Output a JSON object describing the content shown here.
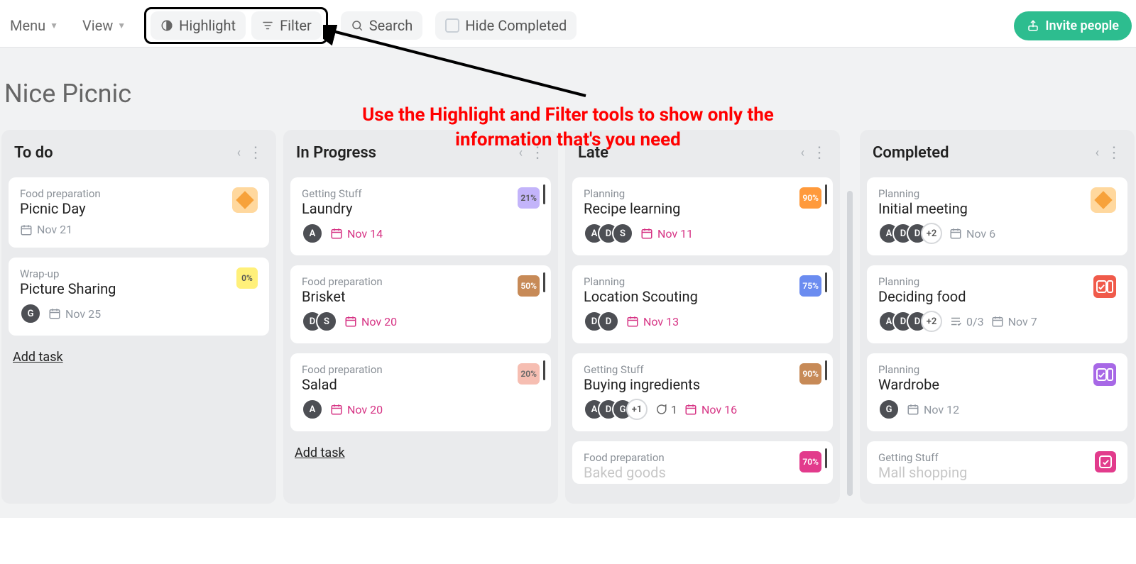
{
  "toolbar": {
    "menu": "Menu",
    "view": "View",
    "highlight": "Highlight",
    "filter": "Filter",
    "search": "Search",
    "hide_completed": "Hide Completed",
    "invite": "Invite people"
  },
  "annotation": {
    "line1": "Use the Highlight and Filter tools to show only the",
    "line2": "information that's you need"
  },
  "board": {
    "title": "Nice Picnic",
    "add_task": "Add task"
  },
  "columns": [
    {
      "title": "To do"
    },
    {
      "title": "In Progress"
    },
    {
      "title": "Late"
    },
    {
      "title": "Completed"
    }
  ],
  "cards": {
    "todo": [
      {
        "cat": "Food preparation",
        "title": "Picnic Day",
        "badge_type": "diamond",
        "badge_text": "",
        "date": "Nov 21",
        "date_style": "grey",
        "avatars": [],
        "more": ""
      },
      {
        "cat": "Wrap-up",
        "title": "Picture Sharing",
        "badge_type": "yellow",
        "badge_text": "0%",
        "date": "Nov 25",
        "date_style": "grey",
        "avatars": [
          "G"
        ],
        "more": ""
      }
    ],
    "inprogress": [
      {
        "cat": "Getting Stuff",
        "title": "Laundry",
        "badge_type": "purple",
        "badge_text": "21%",
        "date": "Nov 14",
        "date_style": "pink",
        "avatars": [
          "A"
        ],
        "more": ""
      },
      {
        "cat": "Food preparation",
        "title": "Brisket",
        "badge_type": "brown",
        "badge_text": "50%",
        "date": "Nov 20",
        "date_style": "pink",
        "avatars": [
          "D",
          "S"
        ],
        "more": ""
      },
      {
        "cat": "Food preparation",
        "title": "Salad",
        "badge_type": "salmon",
        "badge_text": "20%",
        "date": "Nov 20",
        "date_style": "pink",
        "avatars": [
          "A"
        ],
        "more": ""
      }
    ],
    "late": [
      {
        "cat": "Planning",
        "title": "Recipe learning",
        "badge_type": "orange",
        "badge_text": "90%",
        "date": "Nov 11",
        "date_style": "pink",
        "avatars": [
          "A",
          "D",
          "S"
        ],
        "more": ""
      },
      {
        "cat": "Planning",
        "title": "Location Scouting",
        "badge_type": "blue",
        "badge_text": "75%",
        "date": "Nov 13",
        "date_style": "pink",
        "avatars": [
          "D",
          "D"
        ],
        "more": ""
      },
      {
        "cat": "Getting Stuff",
        "title": "Buying ingredients",
        "badge_type": "brown",
        "badge_text": "90%",
        "date": "Nov 16",
        "date_style": "pink",
        "avatars": [
          "A",
          "D",
          "G"
        ],
        "more": "+1",
        "comments": "1"
      },
      {
        "cat": "Food preparation",
        "title": "Baked goods",
        "badge_type": "pinkb",
        "badge_text": "70%",
        "date": "",
        "date_style": "",
        "avatars": [],
        "more": ""
      }
    ],
    "completed": [
      {
        "cat": "Planning",
        "title": "Initial meeting",
        "badge_type": "diamond",
        "badge_text": "",
        "date": "Nov 6",
        "date_style": "grey",
        "avatars": [
          "A",
          "D",
          "D"
        ],
        "more": "+2"
      },
      {
        "cat": "Planning",
        "title": "Deciding food",
        "badge_type": "redcheck",
        "badge_text": "",
        "date": "Nov 7",
        "date_style": "grey",
        "avatars": [
          "A",
          "D",
          "D"
        ],
        "more": "+2",
        "checklist": "0/3"
      },
      {
        "cat": "Planning",
        "title": "Wardrobe",
        "badge_type": "purplecheck",
        "badge_text": "",
        "date": "Nov 12",
        "date_style": "grey",
        "avatars": [
          "G"
        ],
        "more": ""
      },
      {
        "cat": "Getting Stuff",
        "title": "Mall shopping",
        "badge_type": "pinkb",
        "badge_text": "",
        "date": "",
        "date_style": "",
        "avatars": [],
        "more": ""
      }
    ]
  }
}
